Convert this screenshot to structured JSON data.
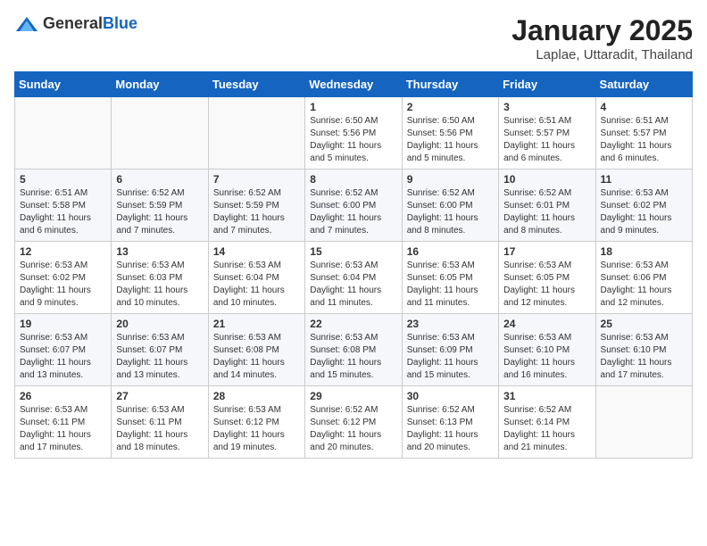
{
  "header": {
    "logo_general": "General",
    "logo_blue": "Blue",
    "month_title": "January 2025",
    "location": "Laplae, Uttaradit, Thailand"
  },
  "weekdays": [
    "Sunday",
    "Monday",
    "Tuesday",
    "Wednesday",
    "Thursday",
    "Friday",
    "Saturday"
  ],
  "weeks": [
    [
      {
        "day": "",
        "sunrise": "",
        "sunset": "",
        "daylight": ""
      },
      {
        "day": "",
        "sunrise": "",
        "sunset": "",
        "daylight": ""
      },
      {
        "day": "",
        "sunrise": "",
        "sunset": "",
        "daylight": ""
      },
      {
        "day": "1",
        "sunrise": "Sunrise: 6:50 AM",
        "sunset": "Sunset: 5:56 PM",
        "daylight": "Daylight: 11 hours and 5 minutes."
      },
      {
        "day": "2",
        "sunrise": "Sunrise: 6:50 AM",
        "sunset": "Sunset: 5:56 PM",
        "daylight": "Daylight: 11 hours and 5 minutes."
      },
      {
        "day": "3",
        "sunrise": "Sunrise: 6:51 AM",
        "sunset": "Sunset: 5:57 PM",
        "daylight": "Daylight: 11 hours and 6 minutes."
      },
      {
        "day": "4",
        "sunrise": "Sunrise: 6:51 AM",
        "sunset": "Sunset: 5:57 PM",
        "daylight": "Daylight: 11 hours and 6 minutes."
      }
    ],
    [
      {
        "day": "5",
        "sunrise": "Sunrise: 6:51 AM",
        "sunset": "Sunset: 5:58 PM",
        "daylight": "Daylight: 11 hours and 6 minutes."
      },
      {
        "day": "6",
        "sunrise": "Sunrise: 6:52 AM",
        "sunset": "Sunset: 5:59 PM",
        "daylight": "Daylight: 11 hours and 7 minutes."
      },
      {
        "day": "7",
        "sunrise": "Sunrise: 6:52 AM",
        "sunset": "Sunset: 5:59 PM",
        "daylight": "Daylight: 11 hours and 7 minutes."
      },
      {
        "day": "8",
        "sunrise": "Sunrise: 6:52 AM",
        "sunset": "Sunset: 6:00 PM",
        "daylight": "Daylight: 11 hours and 7 minutes."
      },
      {
        "day": "9",
        "sunrise": "Sunrise: 6:52 AM",
        "sunset": "Sunset: 6:00 PM",
        "daylight": "Daylight: 11 hours and 8 minutes."
      },
      {
        "day": "10",
        "sunrise": "Sunrise: 6:52 AM",
        "sunset": "Sunset: 6:01 PM",
        "daylight": "Daylight: 11 hours and 8 minutes."
      },
      {
        "day": "11",
        "sunrise": "Sunrise: 6:53 AM",
        "sunset": "Sunset: 6:02 PM",
        "daylight": "Daylight: 11 hours and 9 minutes."
      }
    ],
    [
      {
        "day": "12",
        "sunrise": "Sunrise: 6:53 AM",
        "sunset": "Sunset: 6:02 PM",
        "daylight": "Daylight: 11 hours and 9 minutes."
      },
      {
        "day": "13",
        "sunrise": "Sunrise: 6:53 AM",
        "sunset": "Sunset: 6:03 PM",
        "daylight": "Daylight: 11 hours and 10 minutes."
      },
      {
        "day": "14",
        "sunrise": "Sunrise: 6:53 AM",
        "sunset": "Sunset: 6:04 PM",
        "daylight": "Daylight: 11 hours and 10 minutes."
      },
      {
        "day": "15",
        "sunrise": "Sunrise: 6:53 AM",
        "sunset": "Sunset: 6:04 PM",
        "daylight": "Daylight: 11 hours and 11 minutes."
      },
      {
        "day": "16",
        "sunrise": "Sunrise: 6:53 AM",
        "sunset": "Sunset: 6:05 PM",
        "daylight": "Daylight: 11 hours and 11 minutes."
      },
      {
        "day": "17",
        "sunrise": "Sunrise: 6:53 AM",
        "sunset": "Sunset: 6:05 PM",
        "daylight": "Daylight: 11 hours and 12 minutes."
      },
      {
        "day": "18",
        "sunrise": "Sunrise: 6:53 AM",
        "sunset": "Sunset: 6:06 PM",
        "daylight": "Daylight: 11 hours and 12 minutes."
      }
    ],
    [
      {
        "day": "19",
        "sunrise": "Sunrise: 6:53 AM",
        "sunset": "Sunset: 6:07 PM",
        "daylight": "Daylight: 11 hours and 13 minutes."
      },
      {
        "day": "20",
        "sunrise": "Sunrise: 6:53 AM",
        "sunset": "Sunset: 6:07 PM",
        "daylight": "Daylight: 11 hours and 13 minutes."
      },
      {
        "day": "21",
        "sunrise": "Sunrise: 6:53 AM",
        "sunset": "Sunset: 6:08 PM",
        "daylight": "Daylight: 11 hours and 14 minutes."
      },
      {
        "day": "22",
        "sunrise": "Sunrise: 6:53 AM",
        "sunset": "Sunset: 6:08 PM",
        "daylight": "Daylight: 11 hours and 15 minutes."
      },
      {
        "day": "23",
        "sunrise": "Sunrise: 6:53 AM",
        "sunset": "Sunset: 6:09 PM",
        "daylight": "Daylight: 11 hours and 15 minutes."
      },
      {
        "day": "24",
        "sunrise": "Sunrise: 6:53 AM",
        "sunset": "Sunset: 6:10 PM",
        "daylight": "Daylight: 11 hours and 16 minutes."
      },
      {
        "day": "25",
        "sunrise": "Sunrise: 6:53 AM",
        "sunset": "Sunset: 6:10 PM",
        "daylight": "Daylight: 11 hours and 17 minutes."
      }
    ],
    [
      {
        "day": "26",
        "sunrise": "Sunrise: 6:53 AM",
        "sunset": "Sunset: 6:11 PM",
        "daylight": "Daylight: 11 hours and 17 minutes."
      },
      {
        "day": "27",
        "sunrise": "Sunrise: 6:53 AM",
        "sunset": "Sunset: 6:11 PM",
        "daylight": "Daylight: 11 hours and 18 minutes."
      },
      {
        "day": "28",
        "sunrise": "Sunrise: 6:53 AM",
        "sunset": "Sunset: 6:12 PM",
        "daylight": "Daylight: 11 hours and 19 minutes."
      },
      {
        "day": "29",
        "sunrise": "Sunrise: 6:52 AM",
        "sunset": "Sunset: 6:12 PM",
        "daylight": "Daylight: 11 hours and 20 minutes."
      },
      {
        "day": "30",
        "sunrise": "Sunrise: 6:52 AM",
        "sunset": "Sunset: 6:13 PM",
        "daylight": "Daylight: 11 hours and 20 minutes."
      },
      {
        "day": "31",
        "sunrise": "Sunrise: 6:52 AM",
        "sunset": "Sunset: 6:14 PM",
        "daylight": "Daylight: 11 hours and 21 minutes."
      },
      {
        "day": "",
        "sunrise": "",
        "sunset": "",
        "daylight": ""
      }
    ]
  ]
}
